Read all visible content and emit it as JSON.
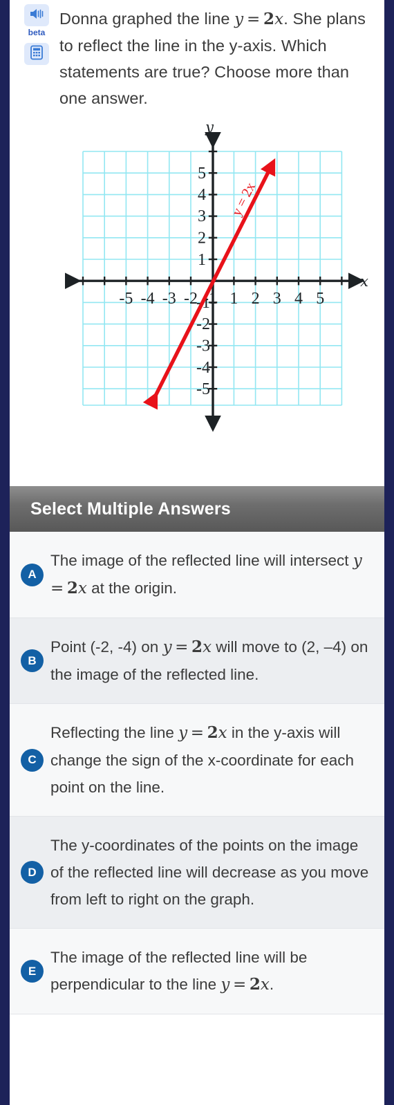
{
  "tools": {
    "audio_icon": "speaker-icon",
    "beta_label": "beta",
    "calculator_icon": "calculator-icon"
  },
  "question": {
    "line1_a": "Donna graphed the line ",
    "line1_math": "y = 2x",
    "line1_b": ".",
    "line2": "She plans to reflect the line in the y-axis. Which statements are true? Choose more than one answer."
  },
  "chart_data": {
    "type": "line",
    "title": "",
    "xlabel": "x",
    "ylabel": "y",
    "xlim": [
      -6,
      6
    ],
    "ylim": [
      -6,
      6
    ],
    "grid": true,
    "grid_color": "#7fe3f0",
    "axis_color": "#1d2225",
    "x_ticks": [
      -5,
      -4,
      -3,
      -2,
      -1,
      1,
      2,
      3,
      4,
      5
    ],
    "x_tick_labels": [
      "-5",
      "-4",
      "-3",
      "-2",
      "-1",
      "1",
      "2",
      "3",
      "4",
      "5"
    ],
    "y_ticks": [
      5,
      4,
      3,
      2,
      1,
      -1,
      -2,
      -3,
      -4,
      -5
    ],
    "y_tick_labels": [
      "5",
      "4",
      "3",
      "2",
      "1",
      "-1",
      "-2",
      "-3",
      "-4",
      "-5"
    ],
    "series": [
      {
        "name": "y = 2x",
        "label": "y = 2x",
        "label_color": "#e8121a",
        "color": "#e8121a",
        "equation": "y = 2x",
        "slope": 2,
        "intercept": 0,
        "arrow_both_ends": true,
        "x": [
          -2.7,
          2.75
        ],
        "y": [
          -5.4,
          5.5
        ]
      }
    ]
  },
  "answers_section": {
    "title": "Select Multiple Answers",
    "options": [
      {
        "letter": "A",
        "parts": [
          {
            "t": "text",
            "v": "The image of the reflected line will intersect "
          },
          {
            "t": "math",
            "v": "y = 2x"
          },
          {
            "t": "text",
            "v": " at the origin."
          }
        ],
        "plain": "The image of the reflected line will intersect y = 2x at the origin."
      },
      {
        "letter": "B",
        "parts": [
          {
            "t": "text",
            "v": "Point (-2, -4) on "
          },
          {
            "t": "math",
            "v": "y = 2x"
          },
          {
            "t": "text",
            "v": " will move to (2, –4) on the image of the reflected line."
          }
        ],
        "plain": "Point (-2, -4) on y = 2x will move to (2, –4) on the image of the reflected line."
      },
      {
        "letter": "C",
        "parts": [
          {
            "t": "text",
            "v": "Reflecting the line "
          },
          {
            "t": "math",
            "v": "y = 2x"
          },
          {
            "t": "text",
            "v": " in the y-axis will change the sign of the x-coordinate for each point on the line."
          }
        ],
        "plain": "Reflecting the line y = 2x in the y-axis will change the sign of the x-coordinate for each point on the line."
      },
      {
        "letter": "D",
        "parts": [
          {
            "t": "text",
            "v": "The y-coordinates of the points on the image of the reflected line will decrease as you move from left to right on the graph."
          }
        ],
        "plain": "The y-coordinates of the points on the image of the reflected line will decrease as you move from left to right on the graph."
      },
      {
        "letter": "E",
        "parts": [
          {
            "t": "text",
            "v": "The image of the reflected line will be perpendicular to the line "
          },
          {
            "t": "math",
            "v": "y = 2x"
          },
          {
            "t": "text",
            "v": "."
          }
        ],
        "plain": "The image of the reflected line will be perpendicular to the line y = 2x."
      }
    ]
  },
  "colors": {
    "page_border": "#1d2259",
    "badge_blue": "#1360a5",
    "bar_gray": "#6e6e6e",
    "line_red": "#e8121a",
    "grid_cyan": "#7fe3f0",
    "tool_bg": "#dfe9fb"
  }
}
